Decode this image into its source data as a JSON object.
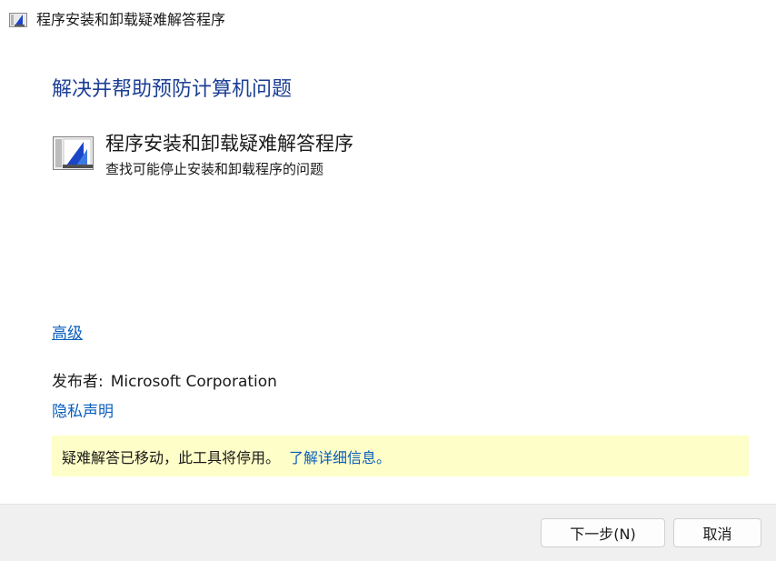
{
  "window": {
    "title": "程序安装和卸载疑难解答程序",
    "icon": "troubleshooter-window-icon"
  },
  "main": {
    "heading": "解决并帮助预防计算机问题",
    "troubleshooter": {
      "icon": "troubleshooter-icon",
      "title": "程序安装和卸载疑难解答程序",
      "description": "查找可能停止安装和卸载程序的问题"
    },
    "advanced_link": "高级",
    "publisher_label": "发布者:",
    "publisher_name": "Microsoft Corporation",
    "privacy_link": "隐私声明",
    "notice": {
      "text": "疑难解答已移动，此工具将停用。",
      "link": "了解详细信息。"
    }
  },
  "footer": {
    "next_label": "下一步(N)",
    "cancel_label": "取消"
  },
  "colors": {
    "heading": "#1c3f94",
    "link": "#0a5ebd",
    "notice_bg": "#fefec8",
    "footer_bg": "#f0f0f0"
  }
}
